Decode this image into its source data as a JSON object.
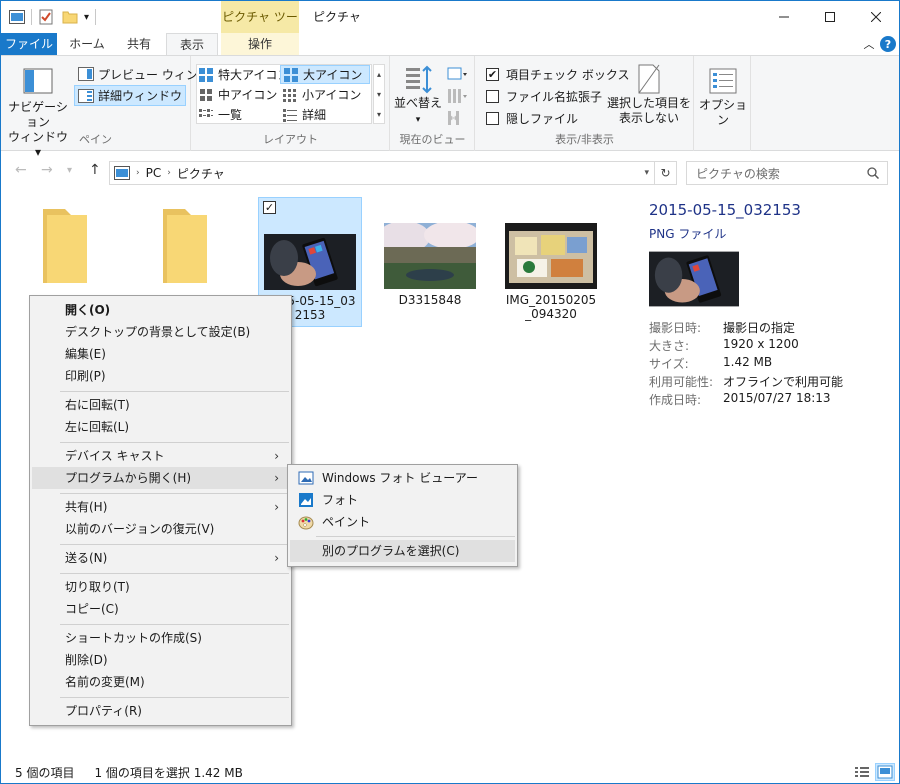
{
  "window": {
    "title": "ピクチャ",
    "context_tab_header": "ピクチャ ツール"
  },
  "tabs": {
    "file": "ファイル",
    "home": "ホーム",
    "share": "共有",
    "view": "表示",
    "manage": "操作"
  },
  "ribbon": {
    "pane": {
      "nav_pane": "ナビゲーション\nウィンドウ ▾",
      "preview": "プレビュー ウィンドウ",
      "details": "詳細ウィンドウ",
      "label": "ペイン"
    },
    "layout": {
      "xl_icons": "特大アイコン",
      "l_icons": "大アイコン",
      "m_icons": "中アイコン",
      "s_icons": "小アイコン",
      "list": "一覧",
      "details": "詳細",
      "label": "レイアウト"
    },
    "current_view": {
      "sort": "並べ替え",
      "label": "現在のビュー"
    },
    "show_hide": {
      "item_checkbox": "項目チェック ボックス",
      "extensions": "ファイル名拡張子",
      "hidden": "隠しファイル",
      "hide_selected": "選択した項目を\n表示しない",
      "label": "表示/非表示"
    },
    "options": "オプション"
  },
  "address": {
    "pc": "PC",
    "folder": "ピクチャ",
    "search_placeholder": "ピクチャの検索"
  },
  "files": [
    {
      "name": ""
    },
    {
      "name": ""
    },
    {
      "name": "2015-05-15_032153"
    },
    {
      "name": "D3315848"
    },
    {
      "name": "IMG_20150205_094320"
    }
  ],
  "details": {
    "title": "2015-05-15_032153",
    "type": "PNG ファイル",
    "props": [
      {
        "key": "撮影日時:",
        "value": "撮影日の指定"
      },
      {
        "key": "大きさ:",
        "value": "1920 x 1200"
      },
      {
        "key": "サイズ:",
        "value": "1.42 MB"
      },
      {
        "key": "利用可能性:",
        "value": "オフラインで利用可能"
      },
      {
        "key": "作成日時:",
        "value": "2015/07/27 18:13"
      }
    ]
  },
  "context_menu": {
    "open": "開く(O)",
    "set_bg": "デスクトップの背景として設定(B)",
    "edit": "編集(E)",
    "print": "印刷(P)",
    "rotate_right": "右に回転(T)",
    "rotate_left": "左に回転(L)",
    "cast": "デバイス キャスト",
    "open_with": "プログラムから開く(H)",
    "share": "共有(H)",
    "restore": "以前のバージョンの復元(V)",
    "send_to": "送る(N)",
    "cut": "切り取り(T)",
    "copy": "コピー(C)",
    "shortcut": "ショートカットの作成(S)",
    "delete": "削除(D)",
    "rename": "名前の変更(M)",
    "properties": "プロパティ(R)"
  },
  "open_with_menu": {
    "photo_viewer": "Windows フォト ビューアー",
    "photos": "フォト",
    "paint": "ペイント",
    "choose": "別のプログラムを選択(C)"
  },
  "status": {
    "count": "5 個の項目",
    "selection": "1 個の項目を選択  1.42 MB"
  },
  "colors": {
    "accent": "#1979ca",
    "selection": "#cce8ff",
    "context_tab": "#f6e9a6"
  }
}
